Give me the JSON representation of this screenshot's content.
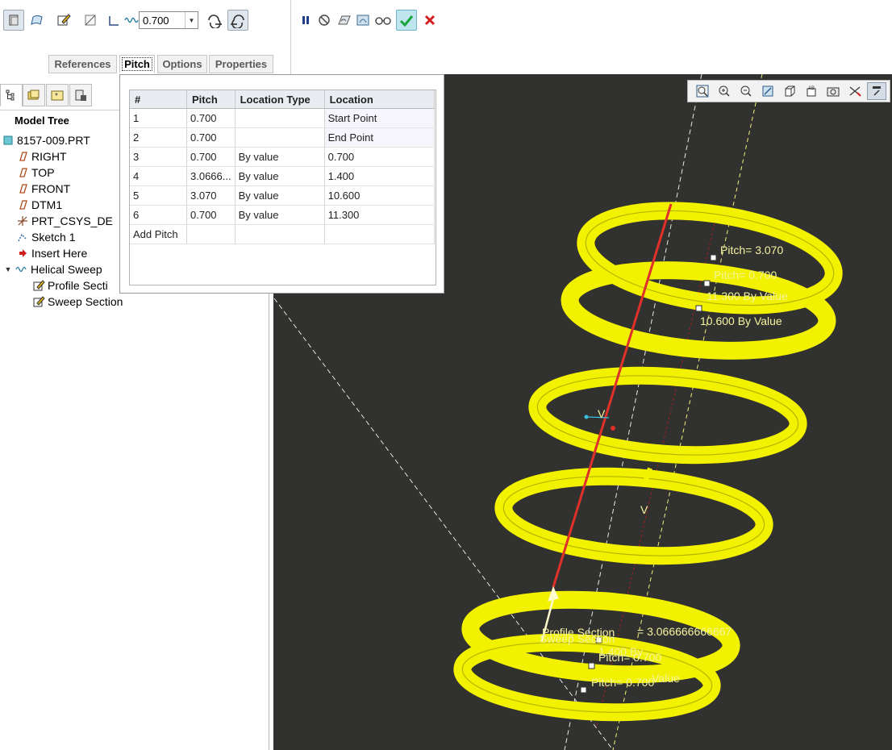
{
  "toolbar": {
    "pitch_value": "0.700",
    "tools": [
      "solid-icon",
      "surface-icon",
      "sketch-icon",
      "remove-material-icon",
      "thicken-icon",
      "helix-icon",
      "combo-dropdown",
      "left-handed-icon",
      "right-handed-icon"
    ],
    "actions": [
      "pause-icon",
      "no-preview-icon",
      "attached-preview-icon",
      "detached-preview-icon",
      "verify-icon",
      "ok-icon",
      "cancel-icon"
    ],
    "tabs": [
      "References",
      "Pitch",
      "Options",
      "Properties"
    ],
    "active_tab": "Pitch"
  },
  "pitch_table": {
    "headers": [
      "#",
      "Pitch",
      "Location Type",
      "Location"
    ],
    "rows": [
      {
        "num": "1",
        "pitch": "0.700",
        "type": "",
        "location": "Start Point"
      },
      {
        "num": "2",
        "pitch": "0.700",
        "type": "",
        "location": "End Point"
      },
      {
        "num": "3",
        "pitch": "0.700",
        "type": "By value",
        "location": "0.700"
      },
      {
        "num": "4",
        "pitch": "3.0666...",
        "type": "By value",
        "location": "1.400"
      },
      {
        "num": "5",
        "pitch": "3.070",
        "type": "By value",
        "location": "10.600"
      },
      {
        "num": "6",
        "pitch": "0.700",
        "type": "By value",
        "location": "11.300"
      }
    ],
    "add_label": "Add Pitch"
  },
  "model_tree": {
    "title": "Model Tree",
    "items": [
      {
        "label": "8157-009.PRT",
        "icon": "part-icon"
      },
      {
        "label": "RIGHT",
        "icon": "datum-plane-icon"
      },
      {
        "label": "TOP",
        "icon": "datum-plane-icon"
      },
      {
        "label": "FRONT",
        "icon": "datum-plane-icon"
      },
      {
        "label": "DTM1",
        "icon": "datum-plane-icon"
      },
      {
        "label": "PRT_CSYS_DE",
        "icon": "csys-icon"
      },
      {
        "label": "Sketch 1",
        "icon": "sketch-icon"
      },
      {
        "label": "Insert Here",
        "icon": "insert-arrow-icon"
      },
      {
        "label": "Helical Sweep",
        "icon": "helical-sweep-icon"
      },
      {
        "label": "Profile Secti",
        "icon": "section-icon"
      },
      {
        "label": "Sweep Section",
        "icon": "section-icon"
      }
    ]
  },
  "annotations": {
    "top_pitch_a": "Pitch= 3.070",
    "top_pitch_b": "Pitch= 0.700",
    "top_loc_a": "11.300 By Value",
    "top_loc_b": "10.600 By Value",
    "bot_profile": "Profile Section",
    "bot_sweep": "Sweep Section",
    "bot_pitch_long": "= 3.066666666667",
    "bot_loc": "1.400 By",
    "bot_pitch_a": "Pitch= 0.700",
    "bot_pitch_b": "Pitch= 0.700",
    "bot_value": "Value",
    "marker_v": "V"
  },
  "colors": {
    "spring": "#f2f200",
    "viewport_bg": "#31312f",
    "axis_red": "#e0302a",
    "ok_green": "#1aa33a",
    "cancel_red": "#d21f1f"
  }
}
